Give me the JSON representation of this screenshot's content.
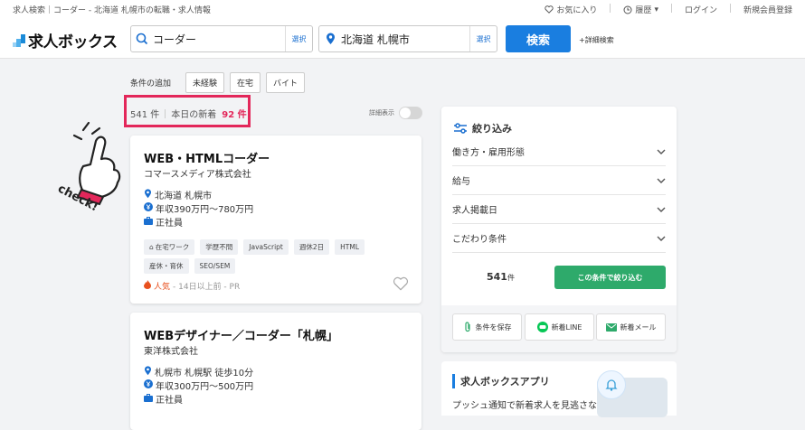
{
  "topbar": {
    "breadcrumb": "求人検索｜コーダー - 北海道 札幌市の転職・求人情報",
    "favorites": "お気に入り",
    "history": "履歴",
    "login": "ログイン",
    "register": "新規会員登録"
  },
  "header": {
    "logo": "求人ボックス",
    "keyword": "コーダー",
    "keyword_select": "選択",
    "location": "北海道 札幌市",
    "location_select": "選択",
    "search_button": "検索",
    "advanced": "+詳細検索"
  },
  "conditions": {
    "label": "条件の追加",
    "chips": [
      "未経験",
      "在宅",
      "バイト"
    ]
  },
  "results": {
    "count": "541 件",
    "today_label": "本日の新着",
    "today_count": "92 件",
    "detail_label": "詳細表示"
  },
  "annotation": {
    "check_text": "check!"
  },
  "jobs": [
    {
      "title": "WEB・HTMLコーダー",
      "company": "コマースメディア株式会社",
      "location": "北海道 札幌市",
      "salary": "年収390万円〜780万円",
      "employment": "正社員",
      "tags": [
        "在宅ワーク",
        "学歴不問",
        "JavaScript",
        "週休2日",
        "HTML",
        "産休・育休",
        "SEO/SEM"
      ],
      "popular": "人気",
      "meta": "- 14日以上前 - PR"
    },
    {
      "title": "WEBデザイナー／コーダー「札幌」",
      "company": "東洋株式会社",
      "location": "札幌市 札幌駅 徒歩10分",
      "salary": "年収300万円〜500万円",
      "employment": "正社員"
    }
  ],
  "sidebar": {
    "title": "絞り込み",
    "filters": [
      "働き方・雇用形態",
      "給与",
      "求人掲載日",
      "こだわり条件"
    ],
    "total": "541",
    "total_unit": "件",
    "apply": "この条件で絞り込む",
    "save": "条件を保存",
    "line": "新着LINE",
    "mail": "新着メール"
  },
  "app": {
    "title": "求人ボックスアプリ",
    "desc": "プッシュ通知で新着求人を見逃さない！"
  },
  "colors": {
    "accent": "#1a7ee0",
    "highlight": "#e3275a",
    "apply": "#2eaa6b"
  }
}
